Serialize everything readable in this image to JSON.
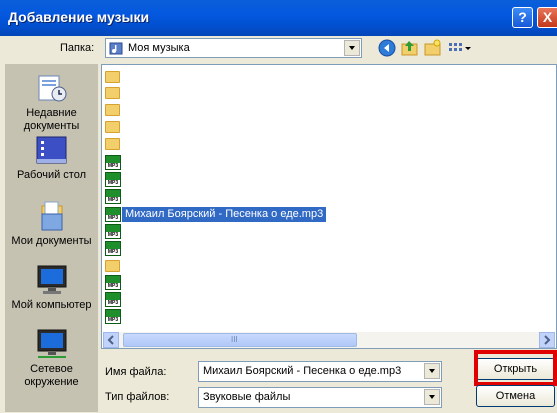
{
  "window": {
    "title": "Добавление музыки",
    "help_glyph": "?",
    "close_glyph": "X"
  },
  "toolbar": {
    "folder_label": "Папка:",
    "folder_value": "Моя музыка"
  },
  "places": [
    {
      "label_line1": "Недавние",
      "label_line2": "документы"
    },
    {
      "label_line1": "Рабочий стол",
      "label_line2": ""
    },
    {
      "label_line1": "Мои документы",
      "label_line2": ""
    },
    {
      "label_line1": "Мой компьютер",
      "label_line2": ""
    },
    {
      "label_line1": "Сетевое",
      "label_line2": "окружение"
    }
  ],
  "files": {
    "selected_name": "Михаил Боярский - Песенка о еде.mp3",
    "icon_text": "MP3",
    "scroll_grip": "III"
  },
  "footer": {
    "filename_label": "Имя файла:",
    "filename_value": "Михаил Боярский - Песенка о еде.mp3",
    "filetype_label": "Тип файлов:",
    "filetype_value": "Звуковые файлы",
    "open_label": "Открыть",
    "cancel_label": "Отмена"
  },
  "colors": {
    "selection": "#316ac5",
    "highlight_box": "#e00000",
    "titlebar": "#0458e0"
  }
}
